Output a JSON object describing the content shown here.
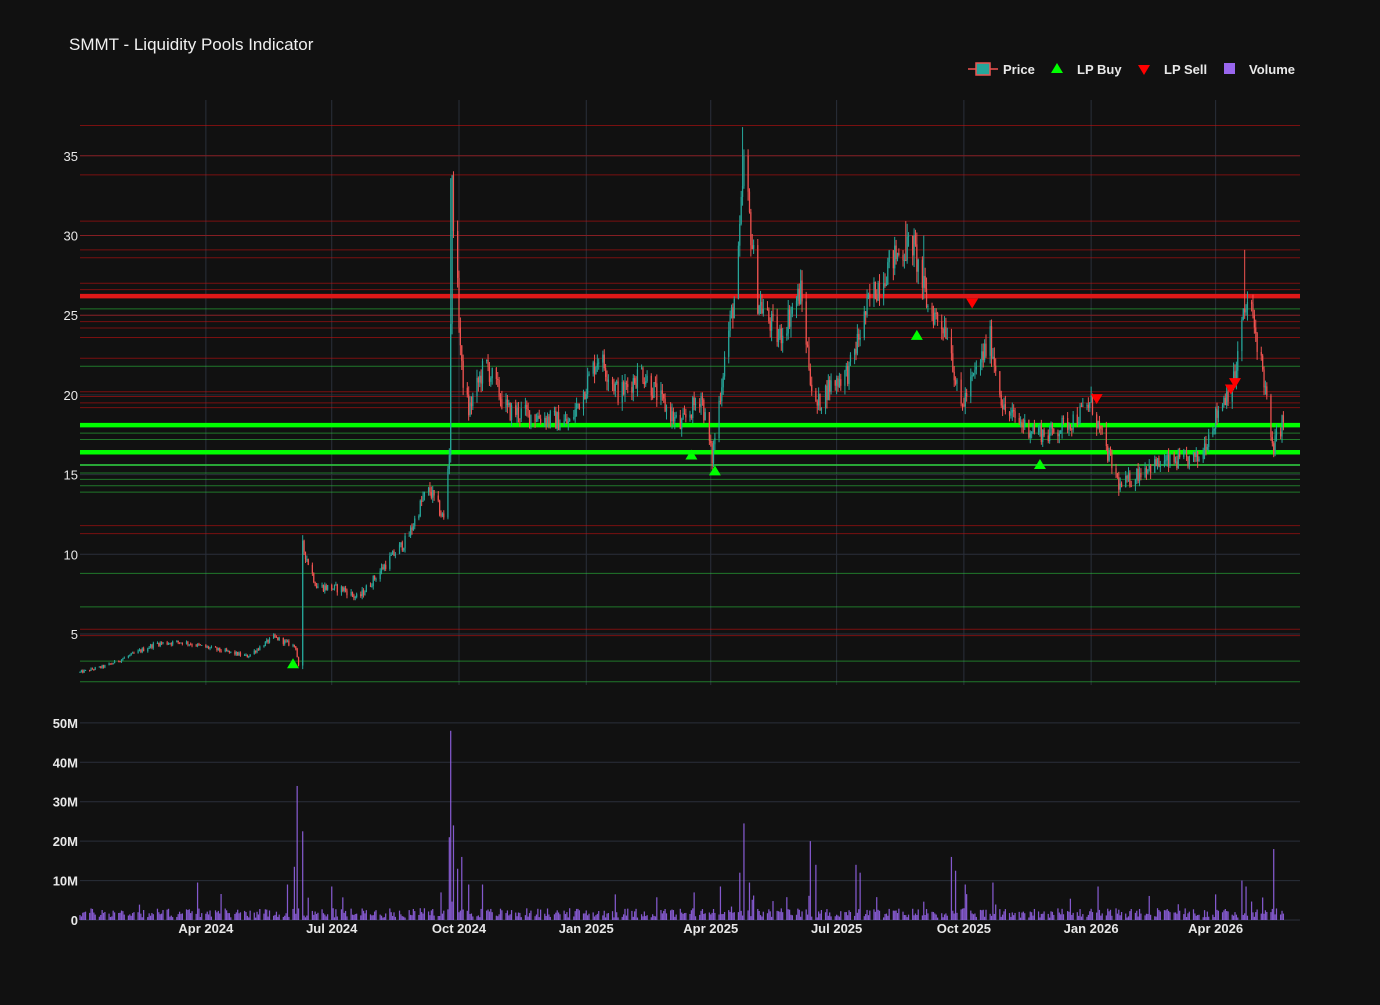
{
  "chart_data": {
    "type": "candlestick",
    "title": "SMMT - Liquidity Pools Indicator",
    "colors": {
      "background": "#111111",
      "grid": "#2a2f3a",
      "text": "#e8e8e8",
      "up": "#26a69a",
      "down": "#ef5350",
      "buy": "#00ff00",
      "sell": "#ff0000",
      "volume": "#9966ee",
      "support": "#2ecc40",
      "resistance": "#d01010"
    },
    "legend": {
      "placement": "top-right",
      "items": [
        {
          "name": "Price",
          "symbol": "candle"
        },
        {
          "name": "LP Buy",
          "symbol": "triangle-up"
        },
        {
          "name": "LP Sell",
          "symbol": "triangle-down"
        },
        {
          "name": "Volume",
          "symbol": "square"
        }
      ]
    },
    "x_range": [
      "2024-01-01",
      "2026-06-01"
    ],
    "x_ticks": [
      {
        "date": "2024-04-01",
        "label": "Apr 2024"
      },
      {
        "date": "2024-07-01",
        "label": "Jul 2024"
      },
      {
        "date": "2024-10-01",
        "label": "Oct 2024"
      },
      {
        "date": "2025-01-01",
        "label": "Jan 2025"
      },
      {
        "date": "2025-04-01",
        "label": "Apr 2025"
      },
      {
        "date": "2025-07-01",
        "label": "Jul 2025"
      },
      {
        "date": "2025-10-01",
        "label": "Oct 2025"
      },
      {
        "date": "2026-01-01",
        "label": "Jan 2026"
      },
      {
        "date": "2026-04-01",
        "label": "Apr 2026"
      }
    ],
    "price_axis": {
      "range": [
        1.8,
        38.5
      ],
      "ticks": [
        {
          "v": 5,
          "label": "5"
        },
        {
          "v": 10,
          "label": "10"
        },
        {
          "v": 15,
          "label": "15"
        },
        {
          "v": 20,
          "label": "20"
        },
        {
          "v": 25,
          "label": "25"
        },
        {
          "v": 30,
          "label": "30"
        },
        {
          "v": 35,
          "label": "35"
        }
      ],
      "grid": true
    },
    "volume_axis": {
      "range": [
        0,
        52000000
      ],
      "ticks": [
        {
          "v": 0,
          "label": "0"
        },
        {
          "v": 10000000,
          "label": "10M"
        },
        {
          "v": 20000000,
          "label": "20M"
        },
        {
          "v": 30000000,
          "label": "30M"
        },
        {
          "v": 40000000,
          "label": "40M"
        },
        {
          "v": 50000000,
          "label": "50M"
        }
      ],
      "grid": true
    },
    "price_anchors": [
      [
        "2024-01-01",
        2.6
      ],
      [
        "2024-01-20",
        3.0
      ],
      [
        "2024-02-10",
        3.8
      ],
      [
        "2024-02-25",
        4.4
      ],
      [
        "2024-03-15",
        4.5
      ],
      [
        "2024-04-10",
        4.0
      ],
      [
        "2024-05-01",
        3.6
      ],
      [
        "2024-05-20",
        4.8
      ],
      [
        "2024-06-05",
        4.2
      ],
      [
        "2024-06-08",
        2.3
      ],
      [
        "2024-06-10",
        10.5
      ],
      [
        "2024-06-20",
        8.0
      ],
      [
        "2024-07-10",
        7.8
      ],
      [
        "2024-07-20",
        7.2
      ],
      [
        "2024-08-10",
        9.5
      ],
      [
        "2024-08-25",
        11.0
      ],
      [
        "2024-09-05",
        13.5
      ],
      [
        "2024-09-10",
        14.0
      ],
      [
        "2024-09-20",
        12.2
      ],
      [
        "2024-09-24",
        16.5
      ],
      [
        "2024-09-26",
        33.0
      ],
      [
        "2024-10-03",
        21.5
      ],
      [
        "2024-10-08",
        19.0
      ],
      [
        "2024-10-20",
        22.0
      ],
      [
        "2024-11-05",
        19.0
      ],
      [
        "2024-11-20",
        18.8
      ],
      [
        "2024-12-05",
        18.5
      ],
      [
        "2024-12-20",
        18.2
      ],
      [
        "2025-01-10",
        22.5
      ],
      [
        "2025-01-25",
        20.0
      ],
      [
        "2025-02-10",
        21.5
      ],
      [
        "2025-02-25",
        19.5
      ],
      [
        "2025-03-10",
        18.0
      ],
      [
        "2025-03-25",
        20.0
      ],
      [
        "2025-04-02",
        16.0
      ],
      [
        "2025-04-12",
        23.0
      ],
      [
        "2025-04-20",
        27.0
      ],
      [
        "2025-04-25",
        34.5
      ],
      [
        "2025-05-05",
        26.0
      ],
      [
        "2025-05-20",
        23.5
      ],
      [
        "2025-06-05",
        26.5
      ],
      [
        "2025-06-15",
        19.0
      ],
      [
        "2025-06-25",
        20.5
      ],
      [
        "2025-07-10",
        21.5
      ],
      [
        "2025-07-25",
        26.0
      ],
      [
        "2025-08-10",
        28.5
      ],
      [
        "2025-08-25",
        29.5
      ],
      [
        "2025-09-05",
        25.5
      ],
      [
        "2025-09-20",
        24.0
      ],
      [
        "2025-09-28",
        19.0
      ],
      [
        "2025-10-10",
        21.5
      ],
      [
        "2025-10-20",
        23.5
      ],
      [
        "2025-10-30",
        19.0
      ],
      [
        "2025-11-15",
        18.0
      ],
      [
        "2025-12-01",
        17.5
      ],
      [
        "2025-12-20",
        18.5
      ],
      [
        "2026-01-01",
        19.5
      ],
      [
        "2026-01-10",
        17.0
      ],
      [
        "2026-01-22",
        14.2
      ],
      [
        "2026-02-10",
        15.5
      ],
      [
        "2026-03-01",
        15.8
      ],
      [
        "2026-03-20",
        16.0
      ],
      [
        "2026-04-05",
        19.5
      ],
      [
        "2026-04-15",
        21.0
      ],
      [
        "2026-04-20",
        24.5
      ],
      [
        "2026-04-25",
        26.0
      ],
      [
        "2026-05-02",
        23.0
      ],
      [
        "2026-05-06",
        21.0
      ],
      [
        "2026-05-12",
        16.5
      ],
      [
        "2026-05-20",
        18.5
      ]
    ],
    "spike_highs": [
      [
        "2024-06-10",
        11.2
      ],
      [
        "2024-09-25",
        33.6
      ],
      [
        "2024-09-26",
        33.8
      ],
      [
        "2025-04-24",
        36.8
      ],
      [
        "2025-08-20",
        30.9
      ],
      [
        "2025-09-02",
        30.0
      ],
      [
        "2026-04-22",
        29.1
      ]
    ],
    "lp_buy": [
      [
        "2024-06-03",
        3.1
      ],
      [
        "2025-03-18",
        16.2
      ],
      [
        "2025-04-04",
        15.2
      ],
      [
        "2025-08-28",
        23.7
      ],
      [
        "2025-11-25",
        15.6
      ]
    ],
    "lp_sell": [
      [
        "2025-10-07",
        25.8
      ],
      [
        "2026-01-05",
        19.8
      ],
      [
        "2026-04-12",
        20.4
      ],
      [
        "2026-04-15",
        20.8
      ]
    ],
    "levels": [
      {
        "v": 36.9,
        "kind": "resistance",
        "strength": 1
      },
      {
        "v": 35.0,
        "kind": "resistance",
        "strength": 1
      },
      {
        "v": 33.8,
        "kind": "resistance",
        "strength": 1
      },
      {
        "v": 30.9,
        "kind": "resistance",
        "strength": 1
      },
      {
        "v": 30.0,
        "kind": "resistance",
        "strength": 1
      },
      {
        "v": 29.1,
        "kind": "resistance",
        "strength": 1
      },
      {
        "v": 28.6,
        "kind": "resistance",
        "strength": 1
      },
      {
        "v": 27.0,
        "kind": "resistance",
        "strength": 1
      },
      {
        "v": 26.6,
        "kind": "resistance",
        "strength": 1
      },
      {
        "v": 26.2,
        "kind": "resistance",
        "strength": 3
      },
      {
        "v": 25.4,
        "kind": "support",
        "strength": 1
      },
      {
        "v": 25.0,
        "kind": "resistance",
        "strength": 1
      },
      {
        "v": 24.6,
        "kind": "resistance",
        "strength": 1
      },
      {
        "v": 24.2,
        "kind": "resistance",
        "strength": 1
      },
      {
        "v": 23.6,
        "kind": "resistance",
        "strength": 1
      },
      {
        "v": 22.3,
        "kind": "resistance",
        "strength": 1
      },
      {
        "v": 21.8,
        "kind": "support",
        "strength": 1
      },
      {
        "v": 20.2,
        "kind": "resistance",
        "strength": 1
      },
      {
        "v": 19.9,
        "kind": "resistance",
        "strength": 1
      },
      {
        "v": 19.5,
        "kind": "resistance",
        "strength": 1
      },
      {
        "v": 19.2,
        "kind": "resistance",
        "strength": 1
      },
      {
        "v": 18.1,
        "kind": "support",
        "strength": 3
      },
      {
        "v": 17.6,
        "kind": "support",
        "strength": 1
      },
      {
        "v": 17.2,
        "kind": "support",
        "strength": 1
      },
      {
        "v": 16.4,
        "kind": "support",
        "strength": 3
      },
      {
        "v": 15.6,
        "kind": "support",
        "strength": 2
      },
      {
        "v": 15.1,
        "kind": "support",
        "strength": 1
      },
      {
        "v": 14.7,
        "kind": "support",
        "strength": 1
      },
      {
        "v": 14.3,
        "kind": "support",
        "strength": 1
      },
      {
        "v": 13.9,
        "kind": "support",
        "strength": 1
      },
      {
        "v": 11.8,
        "kind": "resistance",
        "strength": 1
      },
      {
        "v": 11.3,
        "kind": "resistance",
        "strength": 1
      },
      {
        "v": 8.8,
        "kind": "support",
        "strength": 1
      },
      {
        "v": 6.7,
        "kind": "support",
        "strength": 1
      },
      {
        "v": 5.3,
        "kind": "resistance",
        "strength": 1
      },
      {
        "v": 4.9,
        "kind": "resistance",
        "strength": 1
      },
      {
        "v": 3.3,
        "kind": "support",
        "strength": 1
      },
      {
        "v": 2.0,
        "kind": "support",
        "strength": 1
      }
    ],
    "volume_base": 2000000,
    "volume_spikes": [
      [
        "2024-03-26",
        9500000
      ],
      [
        "2024-05-30",
        9000000
      ],
      [
        "2024-06-04",
        13500000
      ],
      [
        "2024-06-06",
        34000000
      ],
      [
        "2024-06-10",
        22500000
      ],
      [
        "2024-07-01",
        8500000
      ],
      [
        "2024-09-18",
        7000000
      ],
      [
        "2024-09-24",
        21000000
      ],
      [
        "2024-09-25",
        48000000
      ],
      [
        "2024-09-27",
        24000000
      ],
      [
        "2024-09-30",
        13000000
      ],
      [
        "2024-10-03",
        16000000
      ],
      [
        "2024-10-08",
        9000000
      ],
      [
        "2024-10-18",
        9000000
      ],
      [
        "2025-01-22",
        6500000
      ],
      [
        "2025-03-20",
        7000000
      ],
      [
        "2025-04-08",
        8500000
      ],
      [
        "2025-04-22",
        12000000
      ],
      [
        "2025-04-25",
        24500000
      ],
      [
        "2025-04-29",
        9500000
      ],
      [
        "2025-06-12",
        20000000
      ],
      [
        "2025-06-16",
        14000000
      ],
      [
        "2025-07-15",
        14000000
      ],
      [
        "2025-07-18",
        12000000
      ],
      [
        "2025-09-22",
        16000000
      ],
      [
        "2025-09-25",
        12500000
      ],
      [
        "2025-10-02",
        9000000
      ],
      [
        "2025-10-22",
        9500000
      ],
      [
        "2026-01-06",
        8500000
      ],
      [
        "2026-04-01",
        6500000
      ],
      [
        "2026-04-20",
        10000000
      ],
      [
        "2026-04-23",
        8500000
      ],
      [
        "2026-05-13",
        18000000
      ],
      [
        "2026-05-16",
        6500000
      ]
    ]
  }
}
